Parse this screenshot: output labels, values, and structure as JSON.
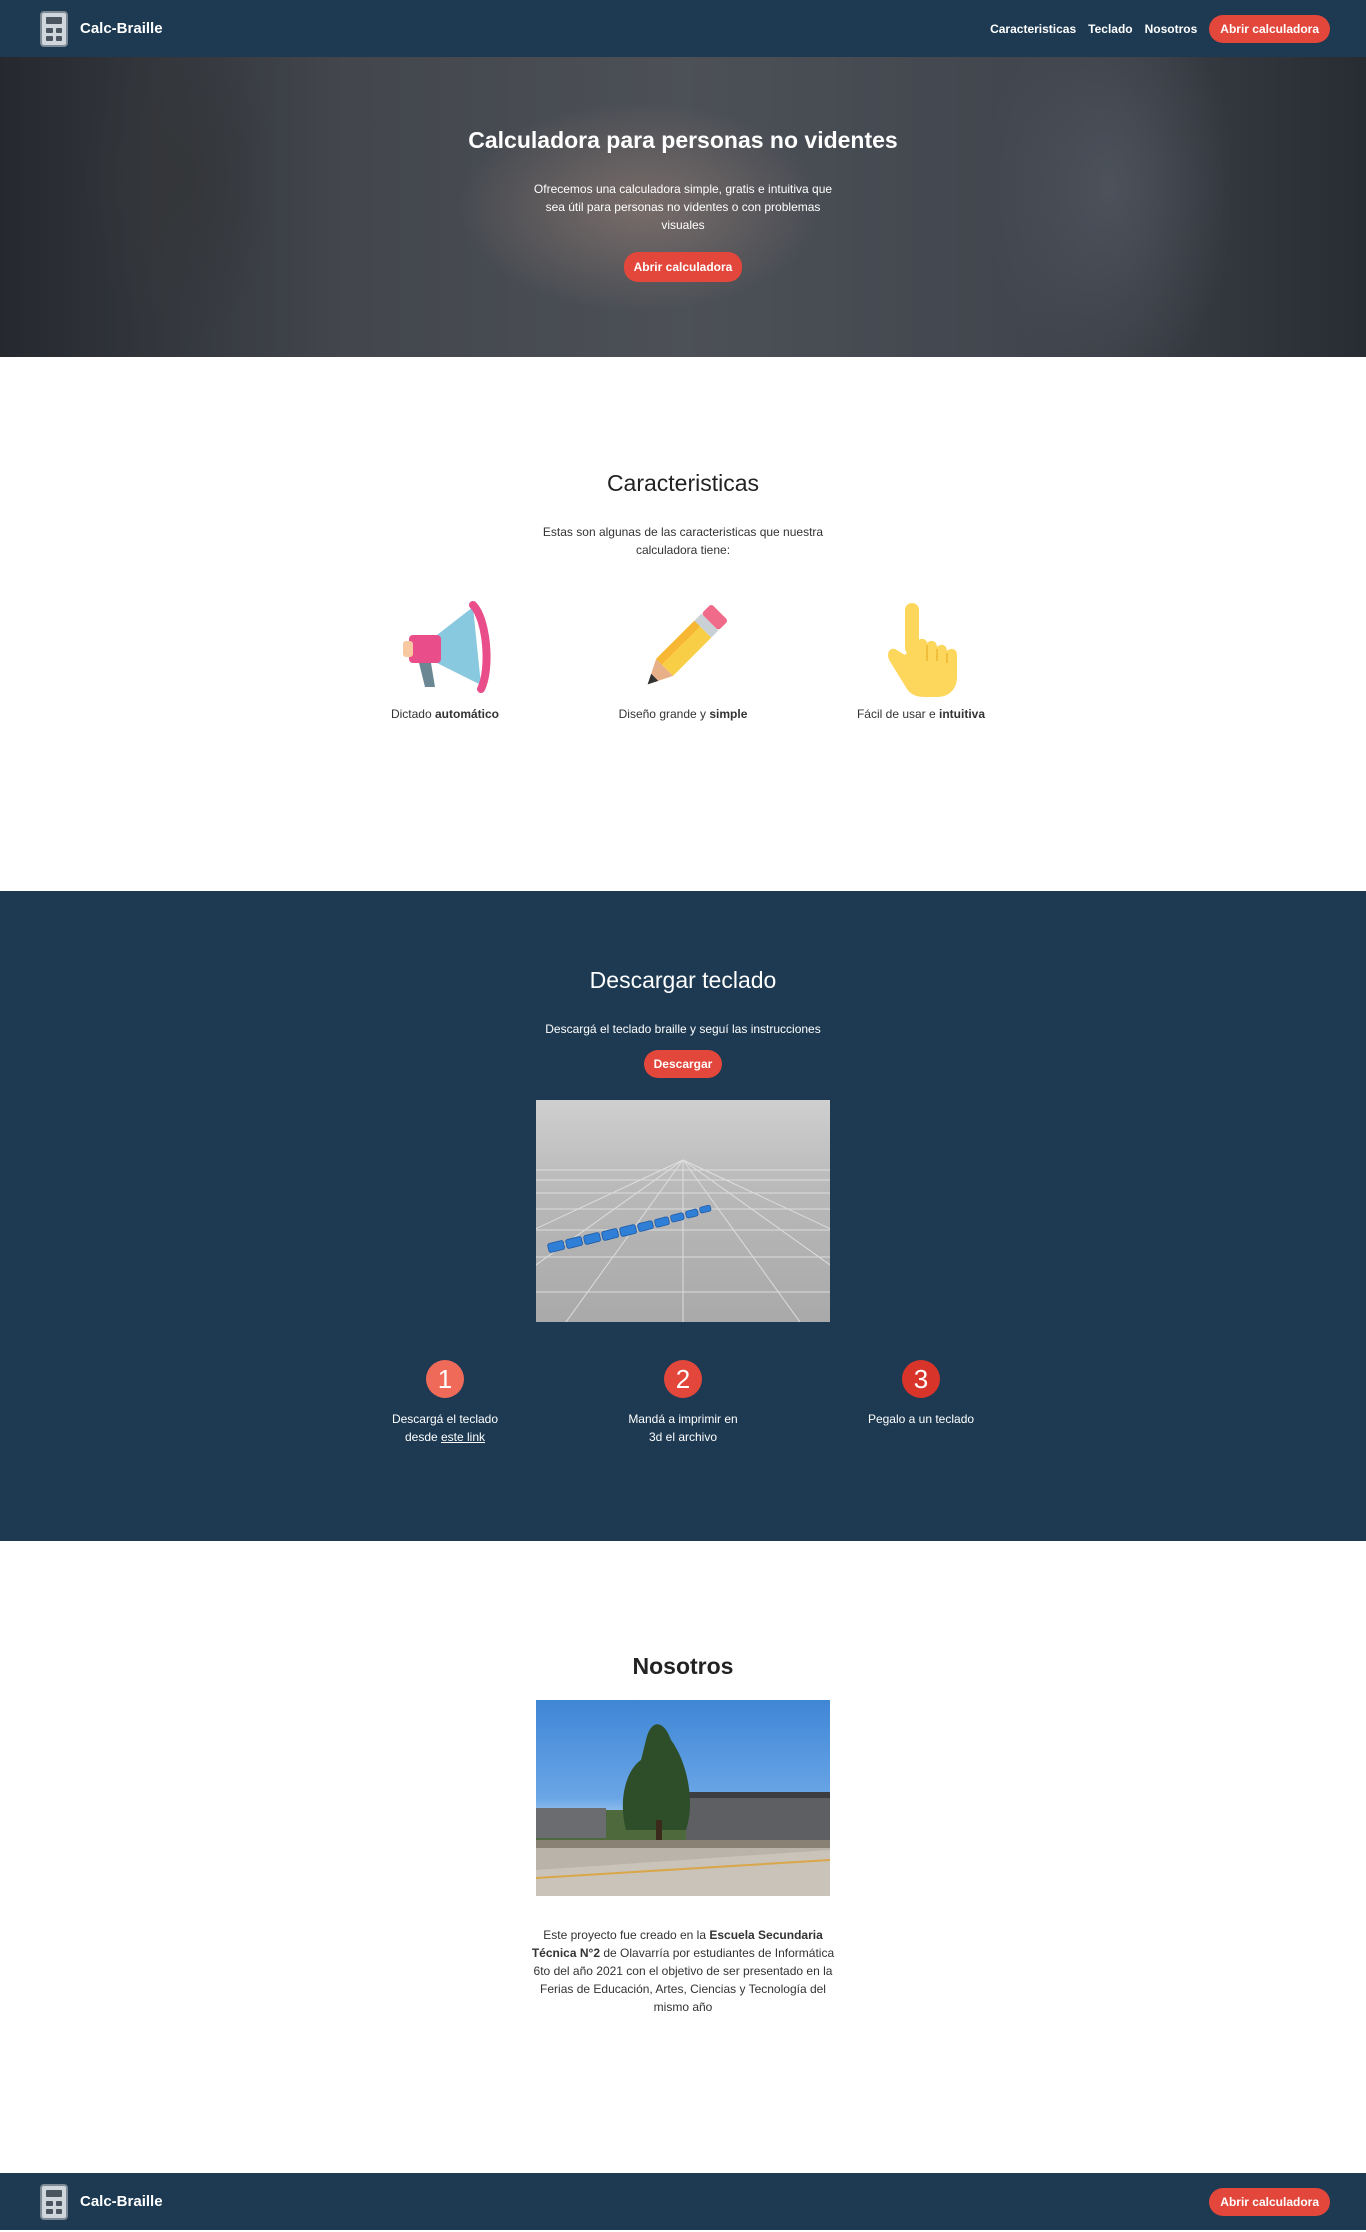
{
  "brand": {
    "name": "Calc-Braille"
  },
  "nav": {
    "links": [
      "Caracteristicas",
      "Teclado",
      "Nosotros"
    ],
    "cta": "Abrir calculadora"
  },
  "hero": {
    "title": "Calculadora para personas no videntes",
    "text": "Ofrecemos una calculadora simple, gratis e intuitiva que sea útil para personas no videntes o con problemas visuales",
    "cta": "Abrir calculadora"
  },
  "features": {
    "title": "Caracteristicas",
    "lead": "Estas son algunas de las caracteristicas que nuestra calculadora tiene:",
    "items": [
      {
        "icon": "megaphone-icon",
        "text": "Dictado ",
        "bold": "automático"
      },
      {
        "icon": "pencil-icon",
        "text": "Diseño grande y ",
        "bold": "simple"
      },
      {
        "icon": "pointing-hand-icon",
        "text": "Fácil de usar e ",
        "bold": "intuitiva"
      }
    ]
  },
  "download": {
    "title": "Descargar teclado",
    "lead": "Descargá el teclado braille y seguí las instrucciones",
    "cta": "Descargar",
    "steps": [
      {
        "num": "1",
        "color": "#f06a5a",
        "text": "Descargá el teclado desde ",
        "link": "este link"
      },
      {
        "num": "2",
        "color": "#e3463a",
        "text": "Mandá a imprimir en 3d el archivo"
      },
      {
        "num": "3",
        "color": "#d8342a",
        "text": "Pegalo a un teclado"
      }
    ]
  },
  "about": {
    "title": "Nosotros",
    "text_pre": "Este proyecto fue creado en la ",
    "text_bold": "Escuela Secundaria Técnica N°2",
    "text_post": " de Olavarría por estudiantes de Informática 6to del año 2021 con el objetivo de ser presentado en la Ferias de Educación, Artes, Ciencias y Tecnología del mismo año"
  },
  "footer": {
    "brand": "Calc-Braille",
    "cta": "Abrir calculadora"
  },
  "colors": {
    "navy": "#1d3a52",
    "accent": "#e3463a"
  }
}
